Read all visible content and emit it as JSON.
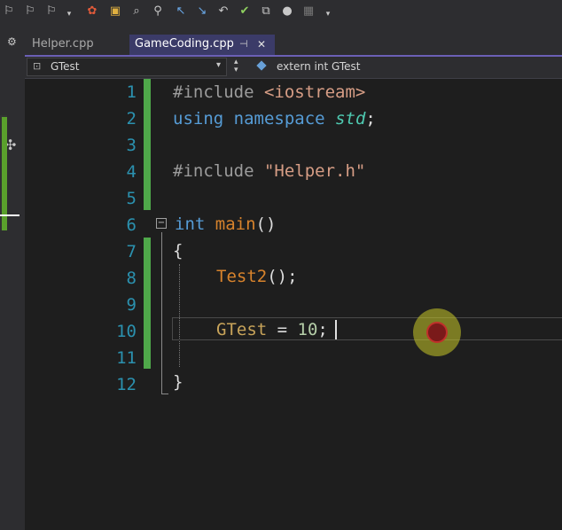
{
  "toolbar": {
    "icons": [
      "bookmark-icon",
      "bookmark-prev-icon",
      "bookmark-next-icon",
      "dropdown-icon",
      "build-icon",
      "folder-icon",
      "find-icon",
      "search-icon",
      "nav-back-icon",
      "nav-forward-icon",
      "undo-icon",
      "spellcheck-icon",
      "copy-icon",
      "toggle-icon",
      "format-icon",
      "dropdown-icon"
    ]
  },
  "tabs": [
    {
      "label": "Helper.cpp",
      "active": false
    },
    {
      "label": "GameCoding.cpp",
      "active": true
    }
  ],
  "navbar": {
    "scope": "GTest",
    "member": "extern int GTest"
  },
  "editor": {
    "line_numbers": [
      "1",
      "2",
      "3",
      "4",
      "5",
      "6",
      "7",
      "8",
      "9",
      "10",
      "11",
      "12"
    ],
    "lines": {
      "l1_pp": "#include ",
      "l1_s": "<iostream>",
      "l2_k1": "using",
      "l2_k2": "namespace",
      "l2_ns": "std",
      "l2_end": ";",
      "l4_pp": "#include ",
      "l4_s": "\"Helper.h\"",
      "l6_k": "int",
      "l6_fn": "main",
      "l6_p": "()",
      "l7": "{",
      "l8_fn": "Test2",
      "l8_p": "();",
      "l10_var": "GTest",
      "l10_op": " = ",
      "l10_num": "10",
      "l10_end": ";",
      "l12": "}"
    },
    "fold_symbol": "−"
  },
  "colors": {
    "keyword": "#569cd6",
    "string": "#d69d85",
    "function": "#d8832c",
    "line_number": "#2b91af",
    "change_bar": "#4fa84a"
  }
}
